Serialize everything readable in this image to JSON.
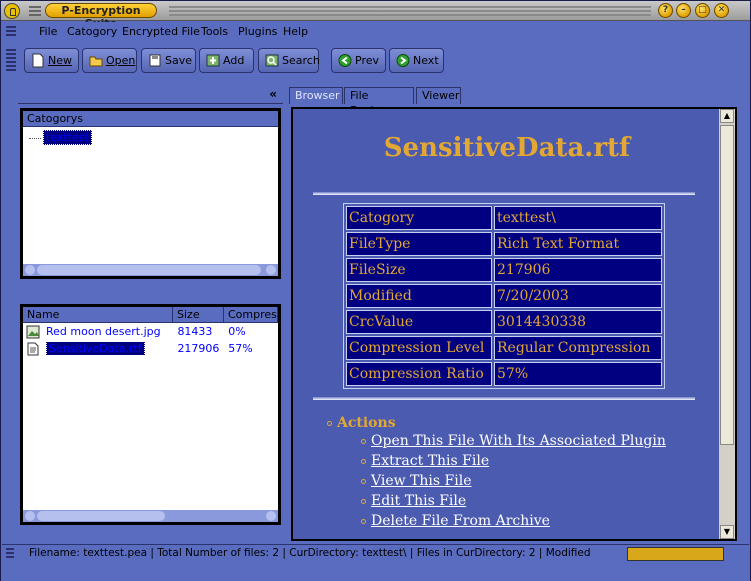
{
  "window": {
    "title": "P-Encryption Suite"
  },
  "menubar": {
    "items": [
      "File",
      "Catogory",
      "Encrypted File",
      "Tools",
      "Plugins",
      "Help"
    ]
  },
  "toolbar": {
    "new_label": "New",
    "open_label": "Open",
    "save_label": "Save",
    "add_label": "Add",
    "search_label": "Search",
    "prev_label": "Prev",
    "next_label": "Next"
  },
  "left_panel": {
    "collapse_glyph": "«",
    "tree": {
      "header": "Catogorys",
      "node": "texttest"
    },
    "files": {
      "columns": [
        "Name",
        "Size",
        "Compression"
      ],
      "rows": [
        {
          "name": "Red moon desert.jpg",
          "size": "81433",
          "compression": "0%",
          "icon": "image-file-icon"
        },
        {
          "name": "SensitiveData.rtf",
          "size": "217906",
          "compression": "57%",
          "icon": "document-file-icon"
        }
      ]
    }
  },
  "right_panel": {
    "tabs": [
      "Browser",
      "File Explorer",
      "Viewer"
    ],
    "doc": {
      "title": "SensitiveData.rtf",
      "fields": [
        {
          "key": "Catogory",
          "value": "texttest\\"
        },
        {
          "key": "FileType",
          "value": "Rich Text Format"
        },
        {
          "key": "FileSize",
          "value": "217906"
        },
        {
          "key": "Modified",
          "value": "7/20/2003"
        },
        {
          "key": "CrcValue",
          "value": "3014430338"
        },
        {
          "key": "Compression Level",
          "value": "Regular Compression"
        },
        {
          "key": "Compression Ratio",
          "value": "57%"
        }
      ],
      "actions_heading": "Actions",
      "actions": [
        "Open This File With Its Associated Plugin",
        "Extract This File",
        "View This File",
        "Edit This File",
        "Delete File From Archive"
      ]
    }
  },
  "status": {
    "text": "Filename: texttest.pea  |  Total Number of files: 2  |  CurDirectory: texttest\\  |  Files in CurDirectory: 2 | Modified"
  },
  "colors": {
    "accent": "#e3a833",
    "panel": "#5a6cbf",
    "selection": "#000080"
  }
}
